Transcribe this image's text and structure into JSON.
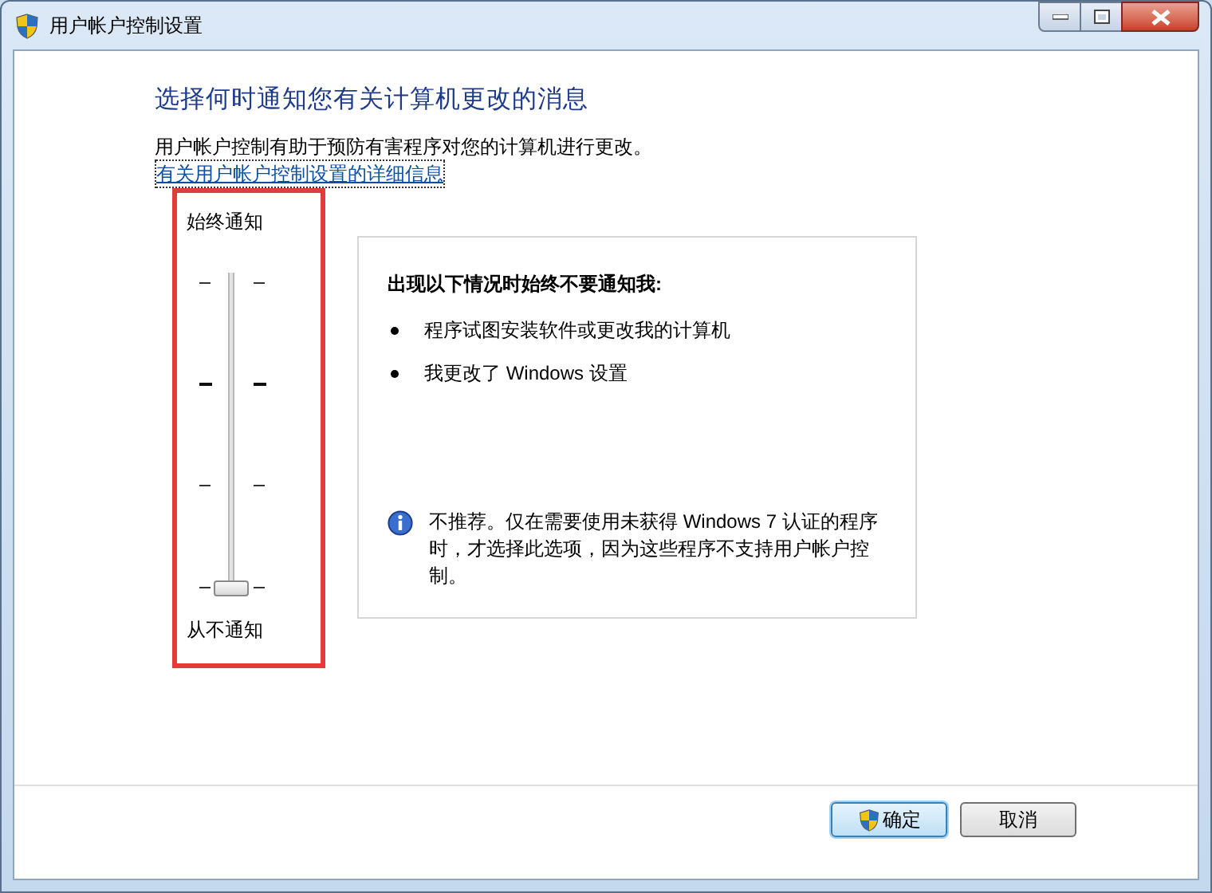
{
  "window": {
    "title": "用户帐户控制设置"
  },
  "heading": "选择何时通知您有关计算机更改的消息",
  "description": "用户帐户控制有助于预防有害程序对您的计算机进行更改。",
  "details_link": "有关用户帐户控制设置的详细信息",
  "slider": {
    "top_label": "始终通知",
    "bottom_label": "从不通知",
    "level": 0
  },
  "info_panel": {
    "title": "出现以下情况时始终不要通知我:",
    "bullets": [
      "程序试图安装软件或更改我的计算机",
      "我更改了 Windows 设置"
    ],
    "note": "不推荐。仅在需要使用未获得 Windows 7 认证的程序时，才选择此选项，因为这些程序不支持用户帐户控制。"
  },
  "buttons": [
    {
      "label": "确定",
      "kind": "shield",
      "default": true
    },
    {
      "label": "取消",
      "kind": "plain",
      "default": false
    }
  ]
}
